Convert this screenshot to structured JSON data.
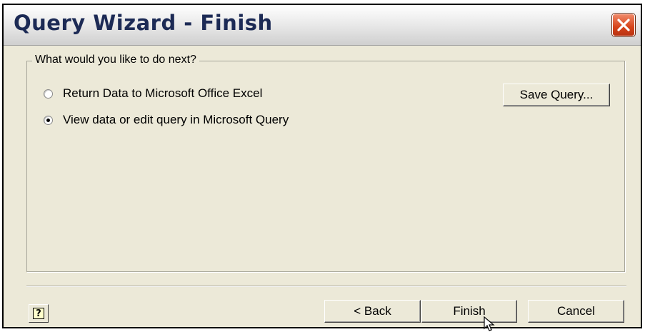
{
  "window": {
    "title": "Query Wizard - Finish"
  },
  "group": {
    "legend": "What would you like to do next?",
    "options": [
      {
        "label": "Return Data to Microsoft Office Excel",
        "selected": false
      },
      {
        "label": "View data or edit query in Microsoft Query",
        "selected": true
      }
    ]
  },
  "buttons": {
    "save_query": "Save Query...",
    "back": "< Back",
    "finish": "Finish",
    "cancel": "Cancel"
  },
  "icons": {
    "close": "close-icon",
    "help": "help-icon",
    "cursor": "mouse-pointer-icon"
  },
  "colors": {
    "close_button": "#d6431a",
    "title_text": "#1c2a55",
    "dialog_background": "#ece9d8"
  }
}
